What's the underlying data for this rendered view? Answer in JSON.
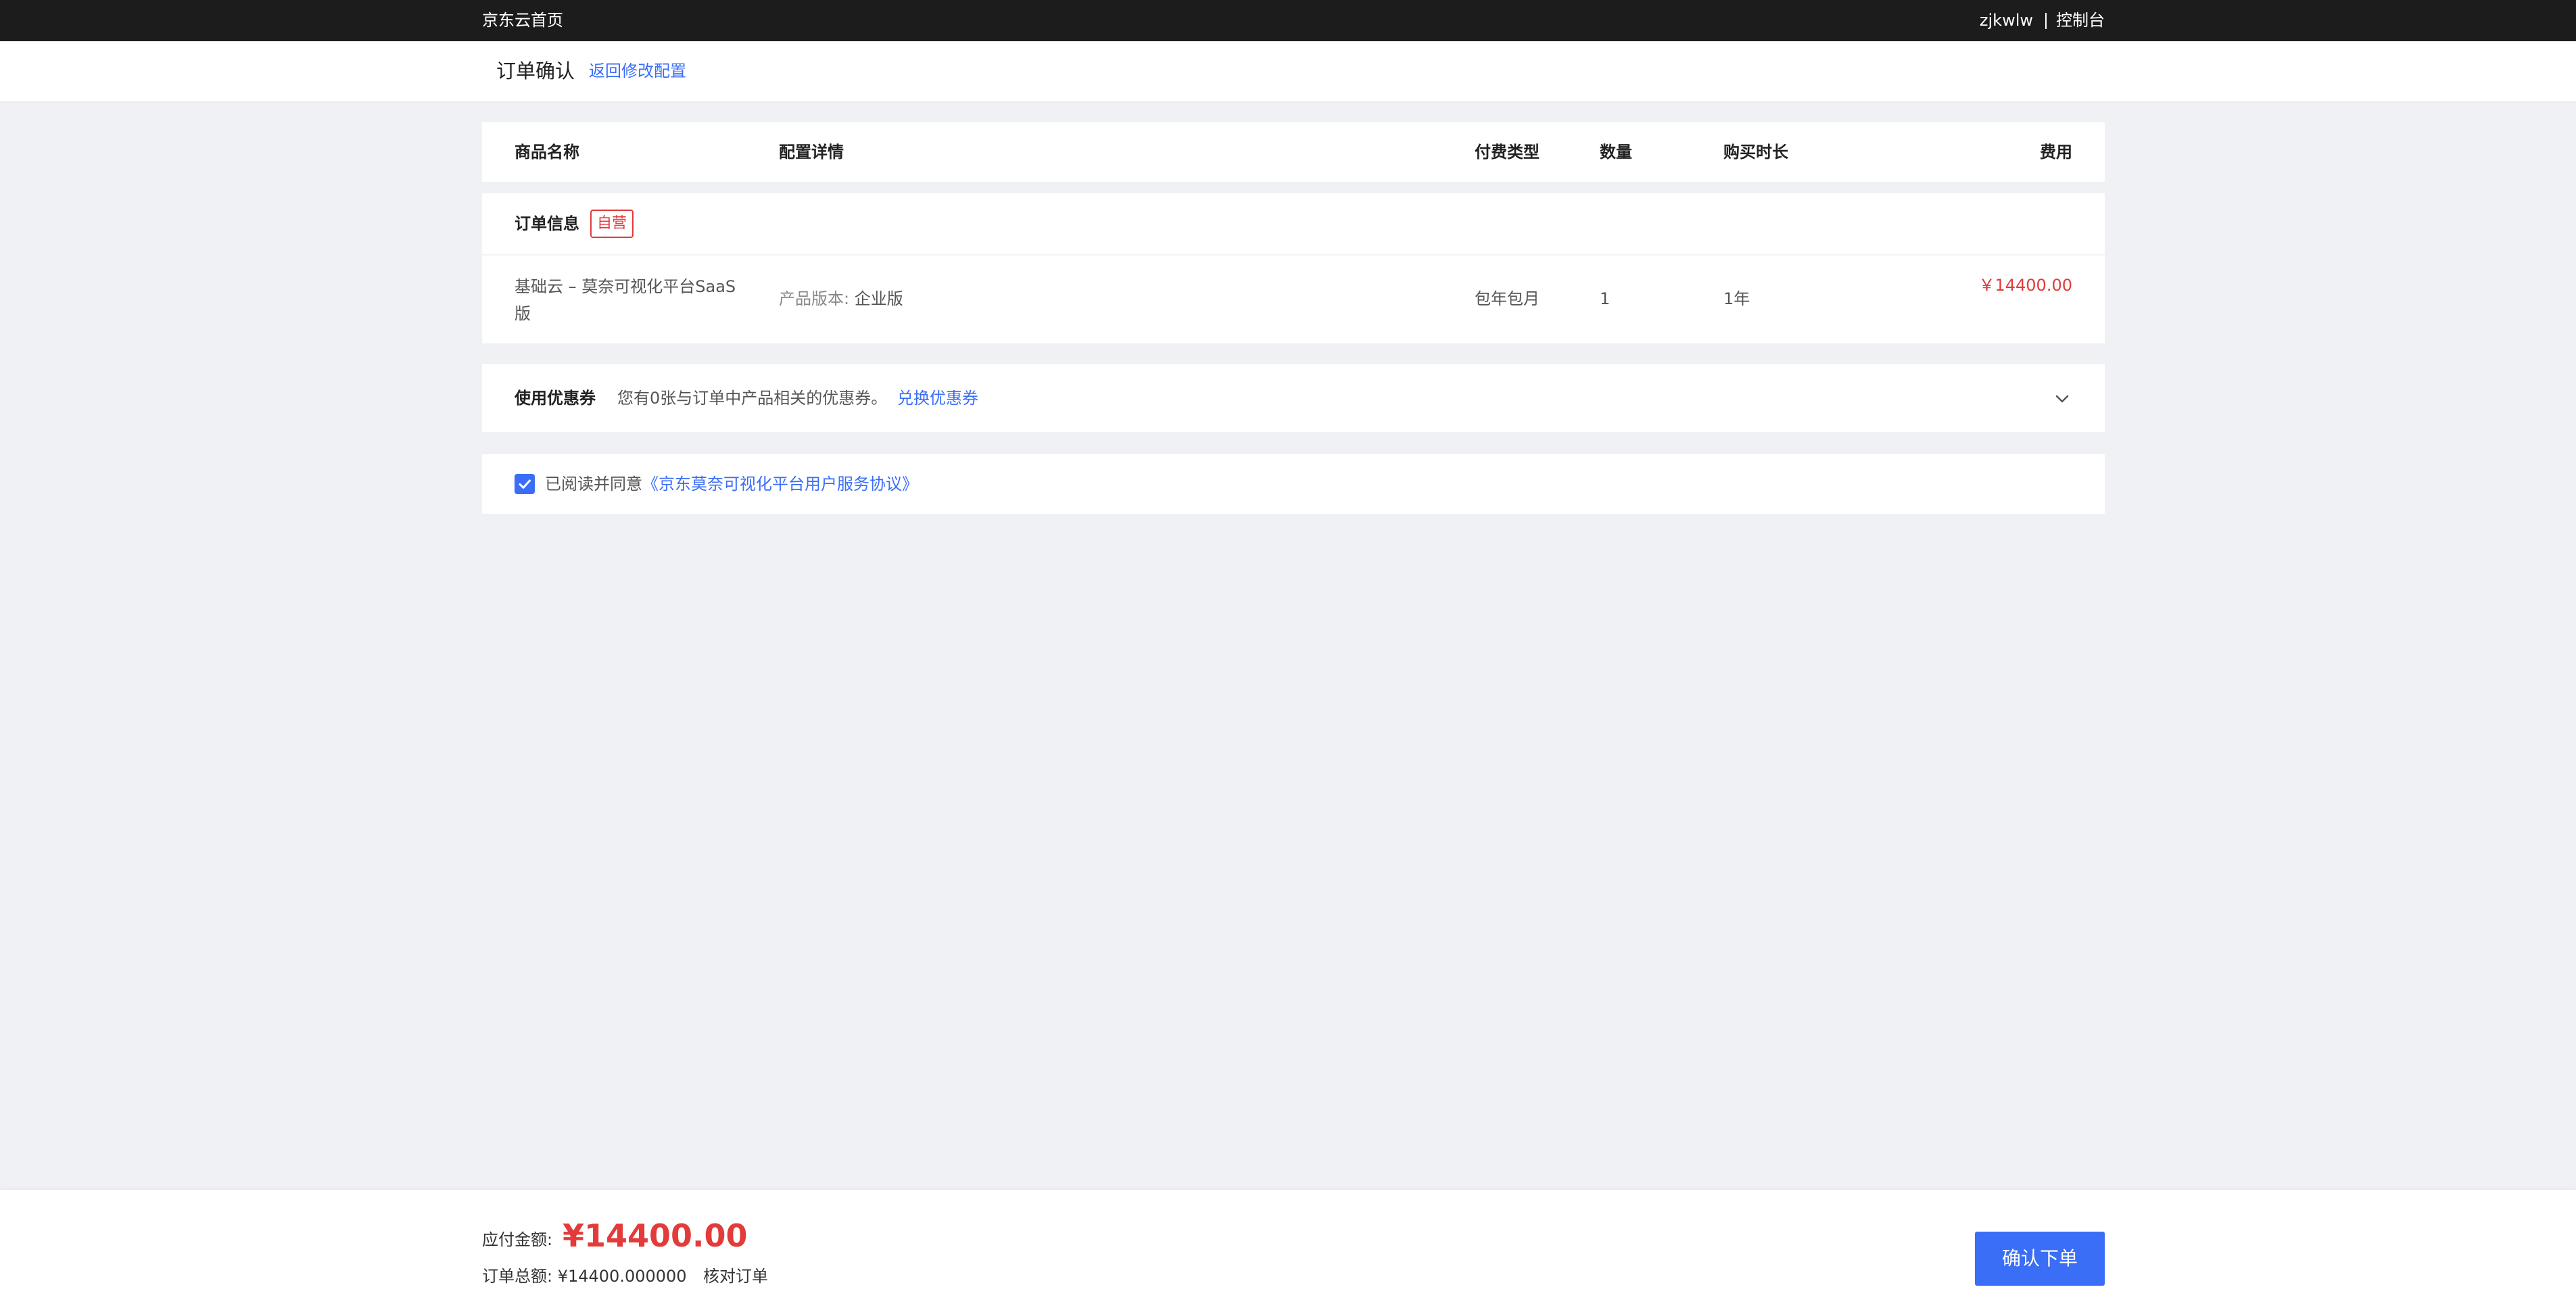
{
  "topbar": {
    "home": "京东云首页",
    "user": "zjkwlw",
    "console": "控制台"
  },
  "titlebar": {
    "title": "订单确认",
    "back": "返回修改配置"
  },
  "table_header": {
    "columns": [
      "商品名称",
      "配置详情",
      "付费类型",
      "数量",
      "购买时长",
      "费用"
    ]
  },
  "order": {
    "section_title": "订单信息",
    "badge": "自营",
    "item": {
      "name": "基础云 – 莫奈可视化平台SaaS版",
      "config_key": "产品版本:",
      "config_value": "企业版",
      "pay_type": "包年包月",
      "quantity": "1",
      "duration": "1年",
      "fee": "￥14400.00"
    }
  },
  "coupon": {
    "label": "使用优惠券",
    "text": "您有0张与订单中产品相关的优惠券。",
    "redeem": "兑换优惠券",
    "icon": "chevron-down-icon"
  },
  "agreement": {
    "checked": true,
    "prefix": "已阅读并同意",
    "link": "《京东莫奈可视化平台用户服务协议》"
  },
  "bottombar": {
    "due_label": "应付金额:",
    "due_amount": "¥14400.00",
    "total": "订单总额:  ¥14400.000000",
    "verify": "核对订单",
    "confirm": "确认下单"
  },
  "colors": {
    "accent": "#3b6ef6",
    "price": "#e33a3a",
    "topbar": "#1c1c1c",
    "background": "#f0f1f5"
  }
}
